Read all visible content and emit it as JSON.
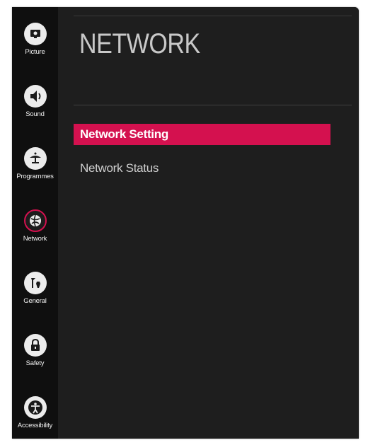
{
  "sidebar": {
    "items": [
      {
        "label": "Picture",
        "icon": "picture-icon"
      },
      {
        "label": "Sound",
        "icon": "speaker-icon"
      },
      {
        "label": "Programmes",
        "icon": "satellite-dish-icon"
      },
      {
        "label": "Network",
        "icon": "network-globe-icon",
        "active": true
      },
      {
        "label": "General",
        "icon": "tools-icon"
      },
      {
        "label": "Safety",
        "icon": "lock-icon"
      },
      {
        "label": "Accessibility",
        "icon": "accessibility-icon"
      }
    ]
  },
  "main": {
    "title": "NETWORK",
    "menu": [
      {
        "label": "Network Setting",
        "selected": true
      },
      {
        "label": "Network Status",
        "selected": false
      }
    ]
  },
  "colors": {
    "accent": "#d4114f",
    "background": "#1e1e1e",
    "sidebar_background": "#0f0f0f"
  }
}
